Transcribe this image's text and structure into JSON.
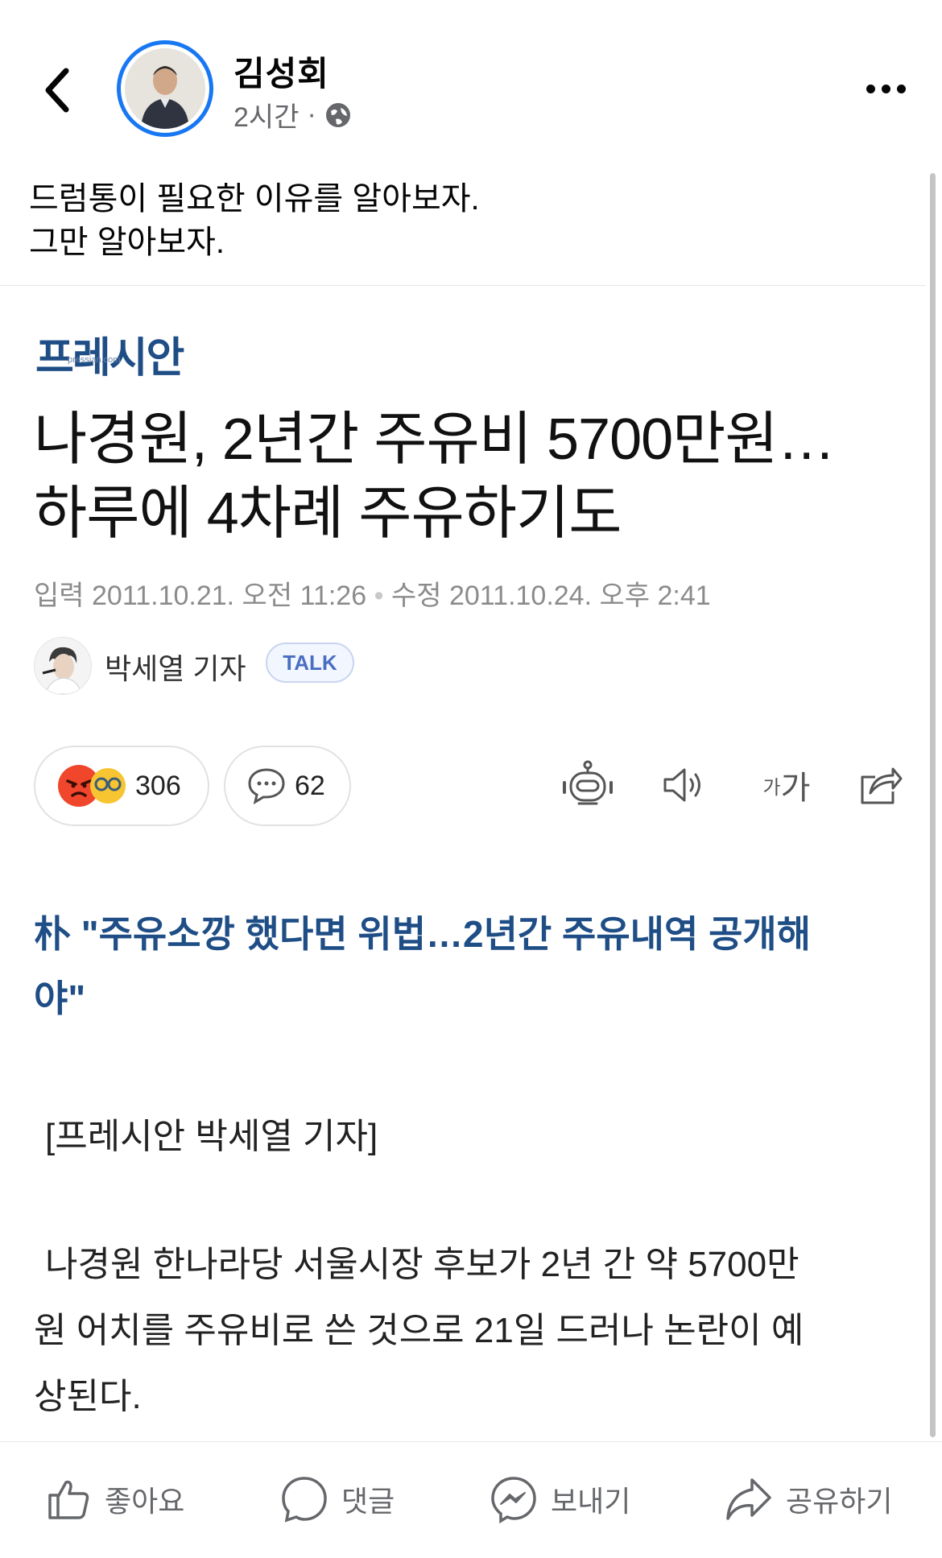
{
  "post": {
    "author_name": "김성회",
    "time": "2시간",
    "separator": "·",
    "caption_line1": "드럼통이 필요한 이유를 알아보자.",
    "caption_line2": "그만 알아보자."
  },
  "article": {
    "publisher_logo": "프레시안",
    "publisher_domain": "pressian.com",
    "headline_line1": "나경원, 2년간 주유비 5700만원…",
    "headline_line2": "하루에 4차례 주유하기도",
    "input_label": "입력",
    "input_date": "2011.10.21. 오전 11:26",
    "date_separator": "•",
    "modified_label": "수정",
    "modified_date": "2011.10.24. 오후 2:41",
    "reporter": "박세열 기자",
    "talk_label": "TALK",
    "reaction_count": "306",
    "comment_count": "62",
    "font_size_label_small": "가",
    "font_size_label_large": "가",
    "subhead_line1": "朴 \"주유소깡 했다면 위법…2년간 주유내역 공개해",
    "subhead_line2": "야\"",
    "byline": "[프레시안 박세열 기자]",
    "body_line1": "나경원 한나라당 서울시장 후보가 2년 간 약 5700만",
    "body_line2": "원 어치를 주유비로 쓴 것으로 21일 드러나 논란이 예",
    "body_line3": "상된다."
  },
  "actions": {
    "like": "좋아요",
    "comment": "댓글",
    "send": "보내기",
    "share": "공유하기"
  },
  "colors": {
    "accent": "#1877f2",
    "publisher_blue": "#1f4e86",
    "secondary_text": "#65676b"
  }
}
